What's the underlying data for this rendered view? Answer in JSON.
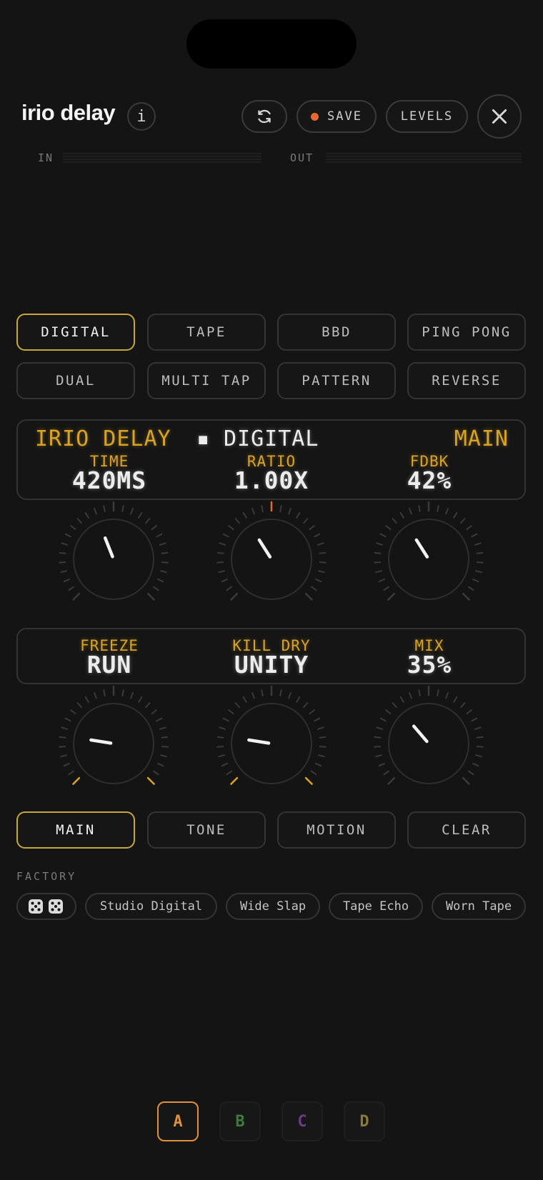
{
  "header": {
    "title": "irio delay",
    "info_label": "i",
    "save_label": "SAVE",
    "levels_label": "LEVELS"
  },
  "meters": {
    "in_label": "IN",
    "out_label": "OUT"
  },
  "modes": [
    {
      "label": "DIGITAL",
      "active": true
    },
    {
      "label": "TAPE"
    },
    {
      "label": "BBD"
    },
    {
      "label": "PING PONG"
    },
    {
      "label": "DUAL"
    },
    {
      "label": "MULTI TAP"
    },
    {
      "label": "PATTERN"
    },
    {
      "label": "REVERSE"
    }
  ],
  "display_main": {
    "left": "IRIO DELAY",
    "separator": "▪",
    "mode": "DIGITAL",
    "page": "MAIN",
    "params": [
      {
        "label": "TIME",
        "value": "420MS"
      },
      {
        "label": "RATIO",
        "value": "1.00X"
      },
      {
        "label": "FDBK",
        "value": "42%"
      }
    ]
  },
  "display_secondary": {
    "params": [
      {
        "label": "FREEZE",
        "value": "RUN"
      },
      {
        "label": "KILL DRY",
        "value": "UNITY"
      },
      {
        "label": "MIX",
        "value": "35%"
      }
    ]
  },
  "knobs": {
    "time": 0.42,
    "ratio": 0.38,
    "fdbk": 0.38,
    "freeze": 0.2,
    "kill_dry": 0.2,
    "mix": 0.35
  },
  "tabs": [
    {
      "label": "MAIN",
      "active": true
    },
    {
      "label": "TONE"
    },
    {
      "label": "MOTION"
    },
    {
      "label": "CLEAR"
    }
  ],
  "factory": {
    "label": "FACTORY",
    "presets": [
      "Studio Digital",
      "Wide Slap",
      "Tape Echo",
      "Worn Tape"
    ]
  },
  "slots": [
    {
      "label": "A",
      "color": "#e0903a"
    },
    {
      "label": "B",
      "color": "#3f7a3a"
    },
    {
      "label": "C",
      "color": "#6a3b86"
    },
    {
      "label": "D",
      "color": "#8a7a3a"
    }
  ],
  "colors": {
    "accent": "#c9a63a",
    "amber": "#d9a327",
    "record": "#e8692d"
  }
}
